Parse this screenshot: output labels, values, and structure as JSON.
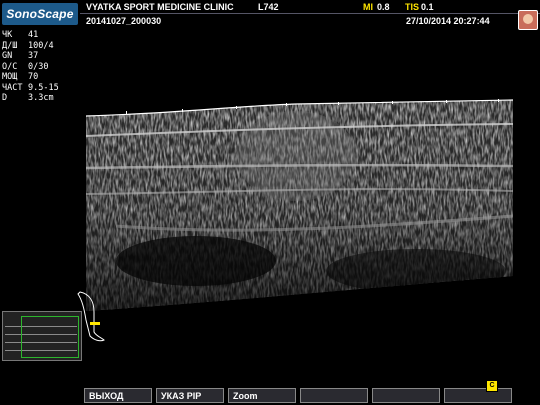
{
  "header": {
    "logo": "SonoScape",
    "clinic": "VYATKA SPORT MEDICINE CLINIC",
    "probe": "L742",
    "mi_label": "MI",
    "mi_value": "0.8",
    "tis_label": "TIS",
    "tis_value": "0.1",
    "study_id": "20141027_200030",
    "datetime": "27/10/2014 20:27:44"
  },
  "params": [
    {
      "key": "ЧК",
      "value": "41"
    },
    {
      "key": "Д/Ш",
      "value": "100/4"
    },
    {
      "key": "GN",
      "value": "37"
    },
    {
      "key": "О/С",
      "value": "0/30"
    },
    {
      "key": "МОЩ",
      "value": "70"
    },
    {
      "key": "ЧАСТ",
      "value": "9.5-15"
    },
    {
      "key": "D",
      "value": "3.3cm"
    }
  ],
  "footer": {
    "exit_label": "ВЫХОД",
    "pip_label": "УКАЗ PIP",
    "zoom_label": "Zoom",
    "btn4_label": "",
    "btn5_label": "",
    "btn6_label": ""
  },
  "colors": {
    "logo_bg": "#1d5a8a",
    "index_yellow": "#ffe600",
    "pip_box": "#2db52d"
  }
}
